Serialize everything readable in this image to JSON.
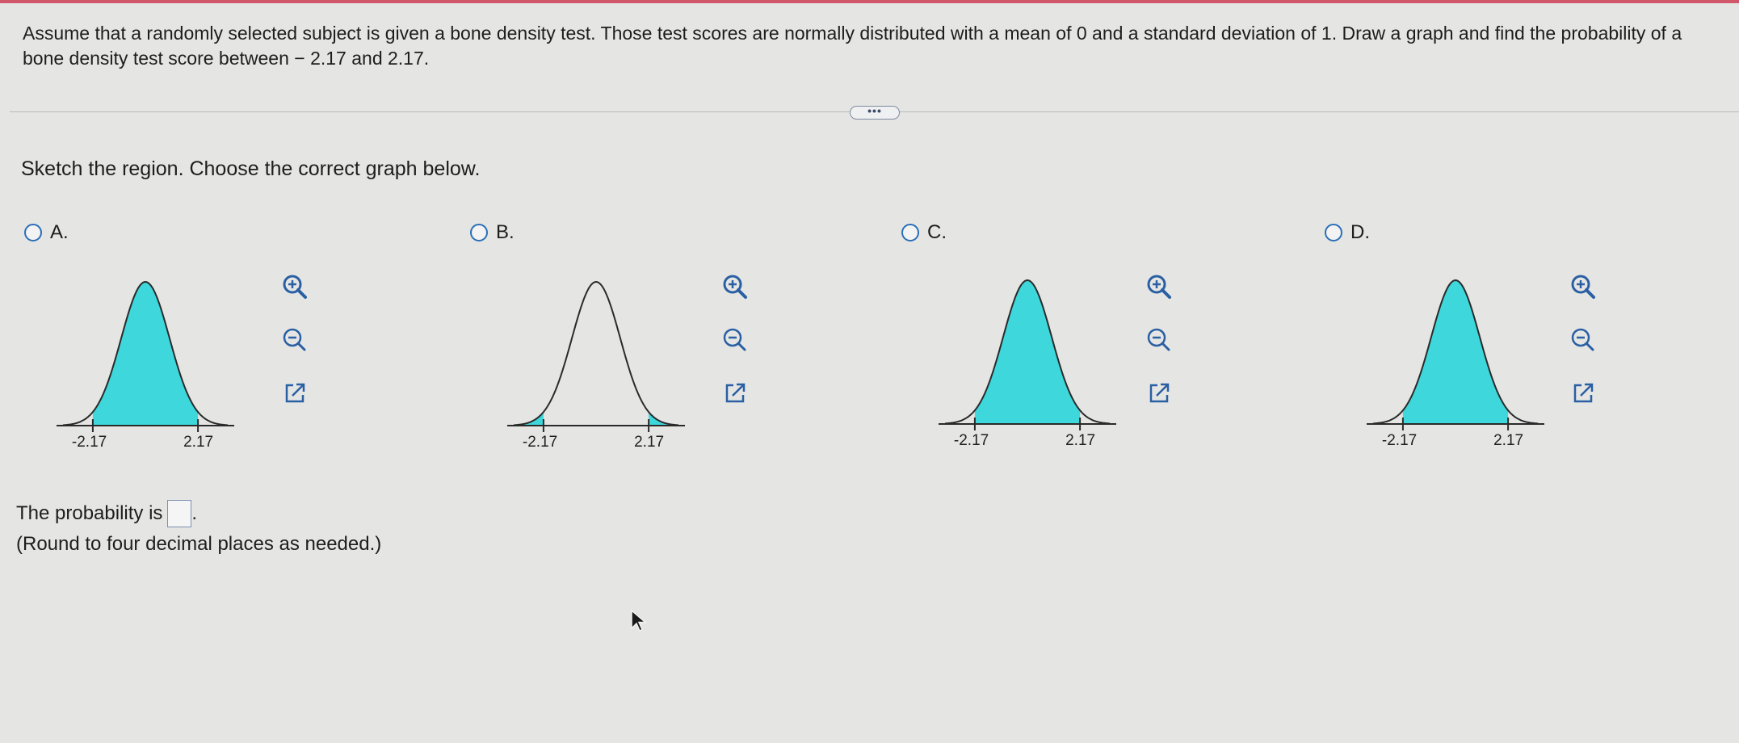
{
  "question": {
    "text": "Assume that a randomly selected subject is given a bone density test. Those test scores are normally distributed with a mean of 0 and a standard deviation of 1. Draw a graph and find the probability of a bone density test score between − 2.17 and 2.17."
  },
  "more_button": {
    "label": "•••"
  },
  "prompt": "Sketch the region. Choose the correct graph below.",
  "options": [
    {
      "letter": "A.",
      "left_label": "-2.17",
      "right_label": "2.17",
      "shading": "between"
    },
    {
      "letter": "B.",
      "left_label": "-2.17",
      "right_label": "2.17",
      "shading": "tails"
    },
    {
      "letter": "C.",
      "left_label": "-2.17",
      "right_label": "2.17",
      "shading": "between"
    },
    {
      "letter": "D.",
      "left_label": "-2.17",
      "right_label": "2.17",
      "shading": "between"
    }
  ],
  "colors": {
    "fill": "#3ed7db",
    "curve": "#2a2a2a",
    "tool_blue": "#2a5fa3"
  },
  "tools": [
    "zoom-in-icon",
    "zoom-out-icon",
    "external-link-icon"
  ],
  "answer": {
    "prefix": "The probability is",
    "suffix": ".",
    "value": "",
    "note": "(Round to four decimal places as needed.)"
  }
}
